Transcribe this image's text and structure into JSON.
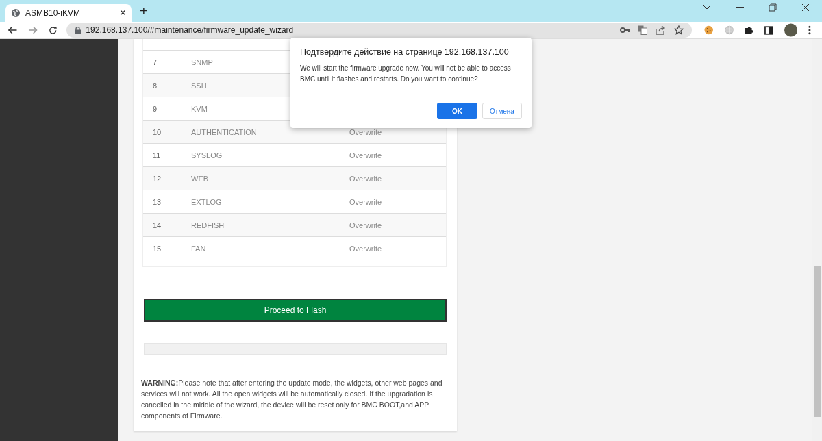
{
  "browser": {
    "tab": {
      "title": "ASMB10-iKVM",
      "close": "×"
    },
    "new_tab": "+",
    "url": "192.168.137.100/#maintenance/firmware_update_wizard"
  },
  "table": {
    "rows": [
      {
        "number": "7",
        "name": "SNMP"
      },
      {
        "number": "8",
        "name": "SSH"
      },
      {
        "number": "9",
        "name": "KVM"
      },
      {
        "number": "10",
        "name": "AUTHENTICATION",
        "value": "Overwrite"
      },
      {
        "number": "11",
        "name": "SYSLOG",
        "value": "Overwrite"
      },
      {
        "number": "12",
        "name": "WEB",
        "value": "Overwrite"
      },
      {
        "number": "13",
        "name": "EXTLOG",
        "value": "Overwrite"
      },
      {
        "number": "14",
        "name": "REDFISH",
        "value": "Overwrite"
      },
      {
        "number": "15",
        "name": "FAN",
        "value": "Overwrite"
      }
    ]
  },
  "flash_button": "Proceed to Flash",
  "progress": {
    "level": 0
  },
  "warning": "**WARNING:**Please note that after entering the update mode, the widgets, other web pages and services will not work. All the open widgets will be automatically closed. If the upgradation is cancelled in the middle of the wizard, the device will be reset only for BMC BOOT,and APP components of Firmware.",
  "dialog": {
    "title": "Подтвердите действие на странице 192.168.137.100",
    "message": "We will start the firmware upgrade now. You will not be able to access BMC until it flashes and restarts. Do you want to continue?",
    "buttons": [
      {
        "label": "OK",
        "kind": "primary"
      },
      {
        "label": "Отмена",
        "kind": "secondary"
      }
    ]
  }
}
